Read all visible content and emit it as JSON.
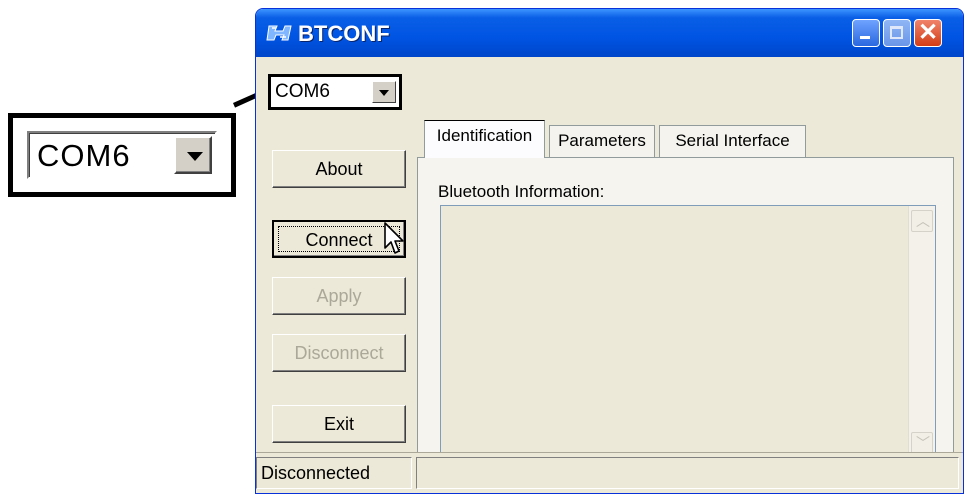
{
  "callout": {
    "port_value": "COM6"
  },
  "window": {
    "title": "BTCONF",
    "port_select": {
      "value": "COM6"
    },
    "buttons": {
      "about": "About",
      "connect": "Connect",
      "apply": "Apply",
      "disconnect": "Disconnect",
      "exit": "Exit"
    },
    "tabs": [
      {
        "label": "Identification",
        "active": true
      },
      {
        "label": "Parameters",
        "active": false
      },
      {
        "label": "Serial Interface",
        "active": false
      }
    ],
    "panel": {
      "group_label": "Bluetooth Information:"
    },
    "status": {
      "text": "Disconnected"
    }
  }
}
